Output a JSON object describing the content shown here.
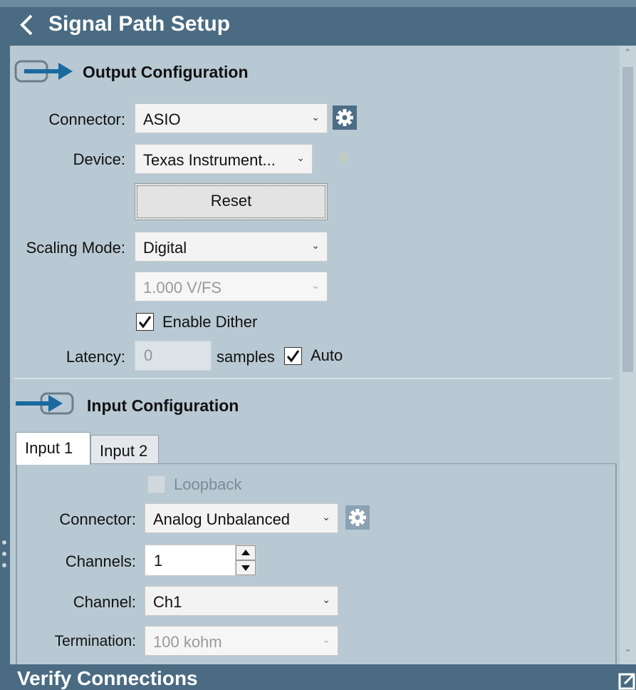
{
  "header": {
    "title": "Signal Path Setup"
  },
  "output": {
    "title": "Output Configuration",
    "connector_label": "Connector:",
    "connector_value": "ASIO",
    "device_label": "Device:",
    "device_value": "Texas Instrument...",
    "reset_label": "Reset",
    "scaling_label": "Scaling Mode:",
    "scaling_value": "Digital",
    "vfs_value": "1.000 V/FS",
    "dither_label": "Enable Dither",
    "dither_checked": true,
    "latency_label": "Latency:",
    "latency_value": "0",
    "samples_label": "samples",
    "auto_label": "Auto",
    "auto_checked": true
  },
  "input": {
    "title": "Input Configuration",
    "tabs": [
      {
        "label": "Input 1"
      },
      {
        "label": "Input 2"
      }
    ],
    "loopback_label": "Loopback",
    "connector_label": "Connector:",
    "connector_value": "Analog Unbalanced",
    "channels_label": "Channels:",
    "channels_value": "1",
    "channel_label": "Channel:",
    "channel_value": "Ch1",
    "termination_label": "Termination:",
    "termination_value": "100 kohm"
  },
  "footer": {
    "title": "Verify Connections"
  },
  "colors": {
    "accent": "#4a6b82",
    "panel": "#b8c9d3",
    "arrow": "#1a6aa0"
  }
}
